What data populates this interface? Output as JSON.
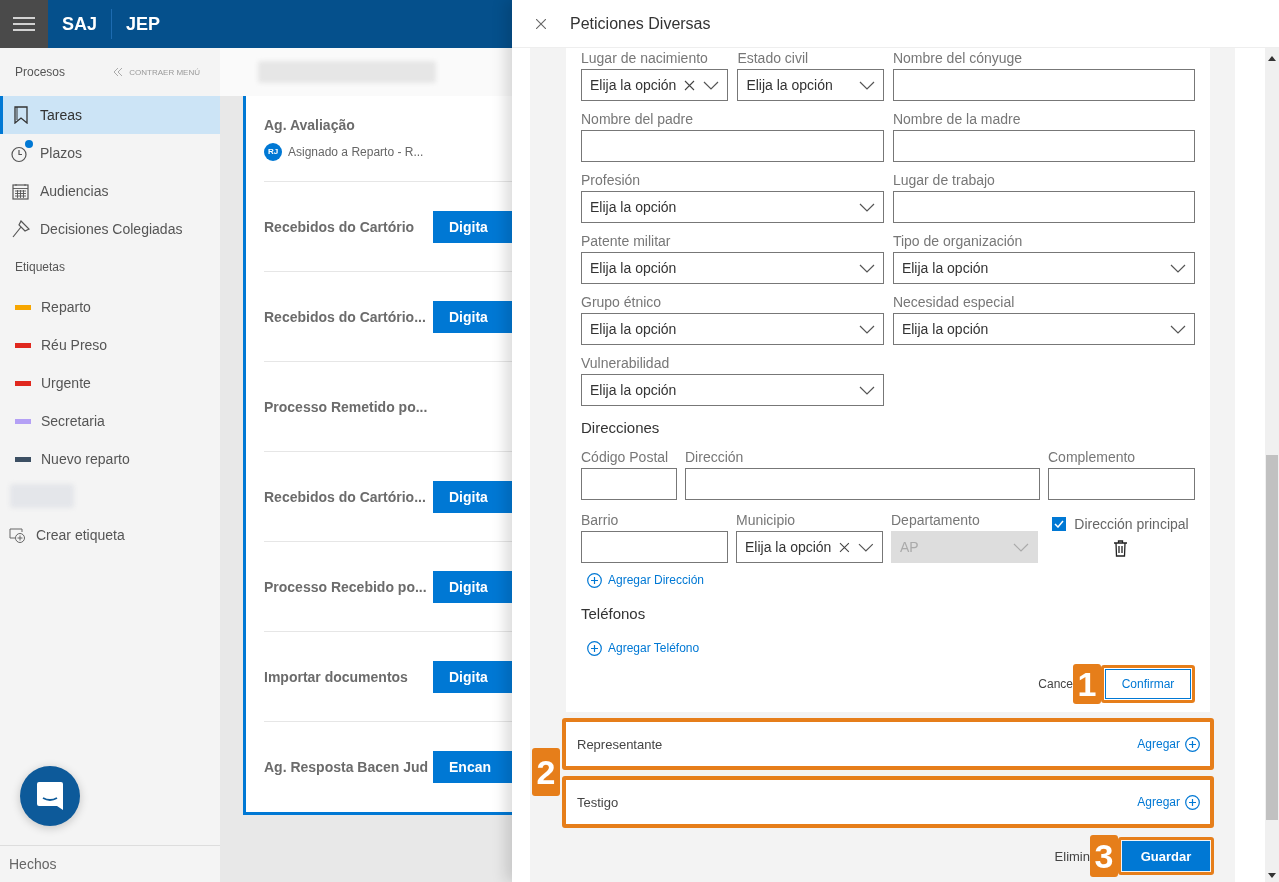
{
  "header": {
    "brand": "SAJ",
    "product": "JEP"
  },
  "sidebar": {
    "section_title": "Procesos",
    "collapse_label": "CONTRAER MENÚ",
    "items": [
      {
        "kind": "bookmark",
        "label": "Tareas",
        "selected": true,
        "notification": false
      },
      {
        "kind": "clock",
        "label": "Plazos",
        "selected": false,
        "notification": true
      },
      {
        "kind": "calendar",
        "label": "Audiencias",
        "selected": false,
        "notification": false
      },
      {
        "kind": "gavel",
        "label": "Decisiones Colegiadas",
        "selected": false,
        "notification": false
      }
    ],
    "tags_title": "Etiquetas",
    "tags": [
      {
        "label": "Reparto",
        "color": "#f7a600"
      },
      {
        "label": "Réu Preso",
        "color": "#e0281e"
      },
      {
        "label": "Urgente",
        "color": "#e0281e"
      },
      {
        "label": "Secretaria",
        "color": "#b4a0f5"
      },
      {
        "label": "Nuevo reparto",
        "color": "#3c4f63"
      }
    ],
    "create_tag": "Crear etiqueta",
    "footer": "Hechos"
  },
  "tasks": [
    {
      "title": "Ag. Avaliação",
      "assignee_initials": "RJ",
      "assignee": "Asignado a Reparto - R..."
    },
    {
      "title": "Recebidos do Cartório",
      "action": "Digita"
    },
    {
      "title": "Recebidos do Cartório...",
      "action": "Digita"
    },
    {
      "title": "Processo Remetido po..."
    },
    {
      "title": "Recebidos do Cartório...",
      "action": "Digita"
    },
    {
      "title": "Processo Recebido po...",
      "action": "Digita"
    },
    {
      "title": "Importar documentos",
      "action": "Digita"
    },
    {
      "title": "Ag. Resposta Bacen Jud",
      "action": "Encan"
    }
  ],
  "panel": {
    "title": "Peticiones Diversas",
    "personal_fields": [
      {
        "label": "Lugar de nacimiento",
        "kind": "clearable_select",
        "value": "Elija la opción"
      },
      {
        "label": "Estado civil",
        "kind": "select",
        "value": "Elija la opción"
      },
      {
        "label": "Nombre del cónyuge",
        "kind": "input"
      },
      {
        "label": "Nombre del padre",
        "kind": "input"
      },
      {
        "label": "Nombre de la madre",
        "kind": "input"
      },
      {
        "label": "Profesión",
        "kind": "select",
        "value": "Elija la opción"
      },
      {
        "label": "Lugar de trabajo",
        "kind": "input"
      },
      {
        "label": "Patente militar",
        "kind": "select",
        "value": "Elija la opción"
      },
      {
        "label": "Tipo de organización",
        "kind": "select",
        "value": "Elija la opción"
      },
      {
        "label": "Grupo étnico",
        "kind": "select",
        "value": "Elija la opción"
      },
      {
        "label": "Necesidad especial",
        "kind": "select",
        "value": "Elija la opción"
      },
      {
        "label": "Vulnerabilidad",
        "kind": "select",
        "value": "Elija la opción"
      }
    ],
    "addresses_title": "Direcciones",
    "address_rows": [
      [
        {
          "label": "Código Postal",
          "kind": "input"
        },
        {
          "label": "Dirección",
          "kind": "input"
        },
        {
          "label": "Complemento",
          "kind": "input"
        }
      ],
      [
        {
          "label": "Barrio",
          "kind": "input"
        },
        {
          "label": "Municipio",
          "kind": "clearable_select",
          "value": "Elija la opción"
        },
        {
          "label": "Departamento",
          "kind": "disabled_select",
          "value": "AP"
        }
      ]
    ],
    "main_address": {
      "label": "Dirección principal",
      "checked": true
    },
    "add_address": "Agregar Dirección",
    "phones_title": "Teléfonos",
    "add_phone": "Agregar Teléfono",
    "cancel": "Cance",
    "confirm": "Confirmar",
    "confirm_callout": "1",
    "parties": [
      {
        "label": "Representante",
        "action": "Agregar"
      },
      {
        "label": "Testigo",
        "action": "Agregar"
      }
    ],
    "parties_callout": "2",
    "delete": "Elimin",
    "save": "Guardar",
    "save_callout": "3"
  }
}
